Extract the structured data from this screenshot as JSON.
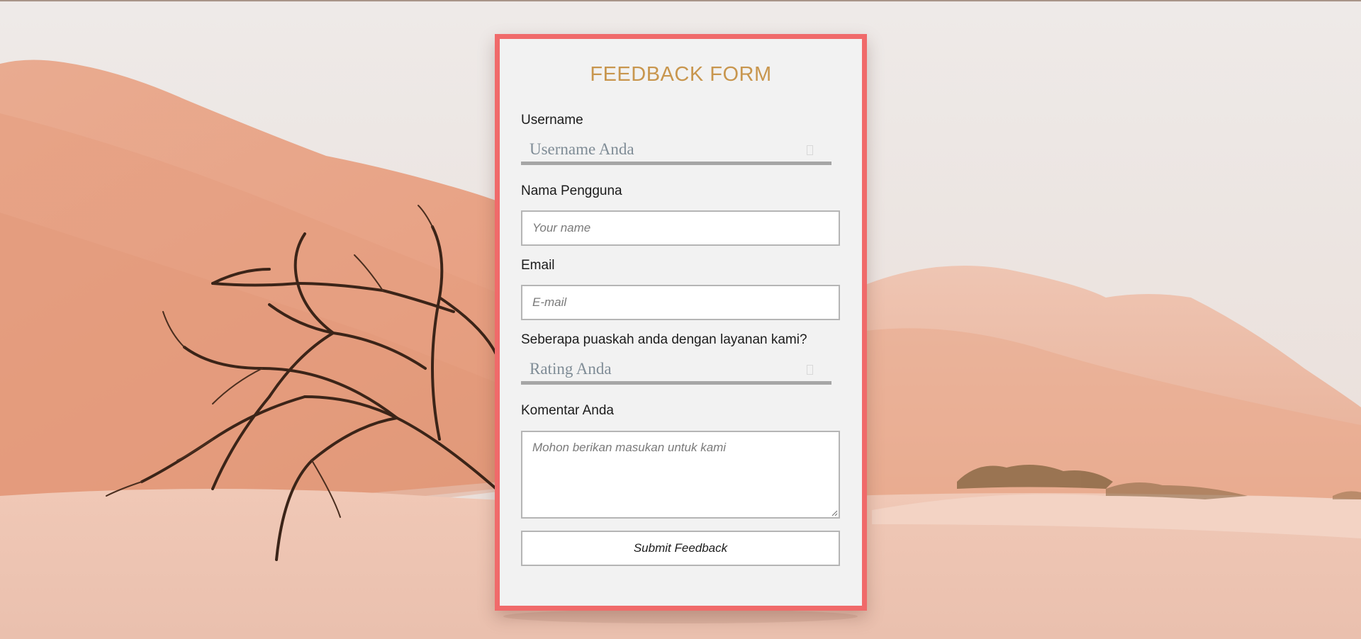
{
  "form": {
    "title": "FEEDBACK FORM",
    "username": {
      "label": "Username",
      "selected": "Username Anda"
    },
    "name": {
      "label": "Nama Pengguna",
      "placeholder": "Your name",
      "value": ""
    },
    "email": {
      "label": "Email",
      "placeholder": "E-mail",
      "value": ""
    },
    "rating": {
      "label": "Seberapa puaskah anda dengan layanan kami?",
      "selected": "Rating Anda"
    },
    "comment": {
      "label": "Komentar Anda",
      "placeholder": "Mohon berikan masukan untuk kami",
      "value": ""
    },
    "submit_label": "Submit Feedback"
  },
  "colors": {
    "card_border": "#f06a6a",
    "card_background": "#f2f2f2",
    "title": "#c8964e",
    "select_text": "#7f8c96",
    "select_underline": "#a6a6a6",
    "input_border": "#b5b5b5"
  },
  "background": {
    "description_icon": "desert-dunes-background"
  }
}
